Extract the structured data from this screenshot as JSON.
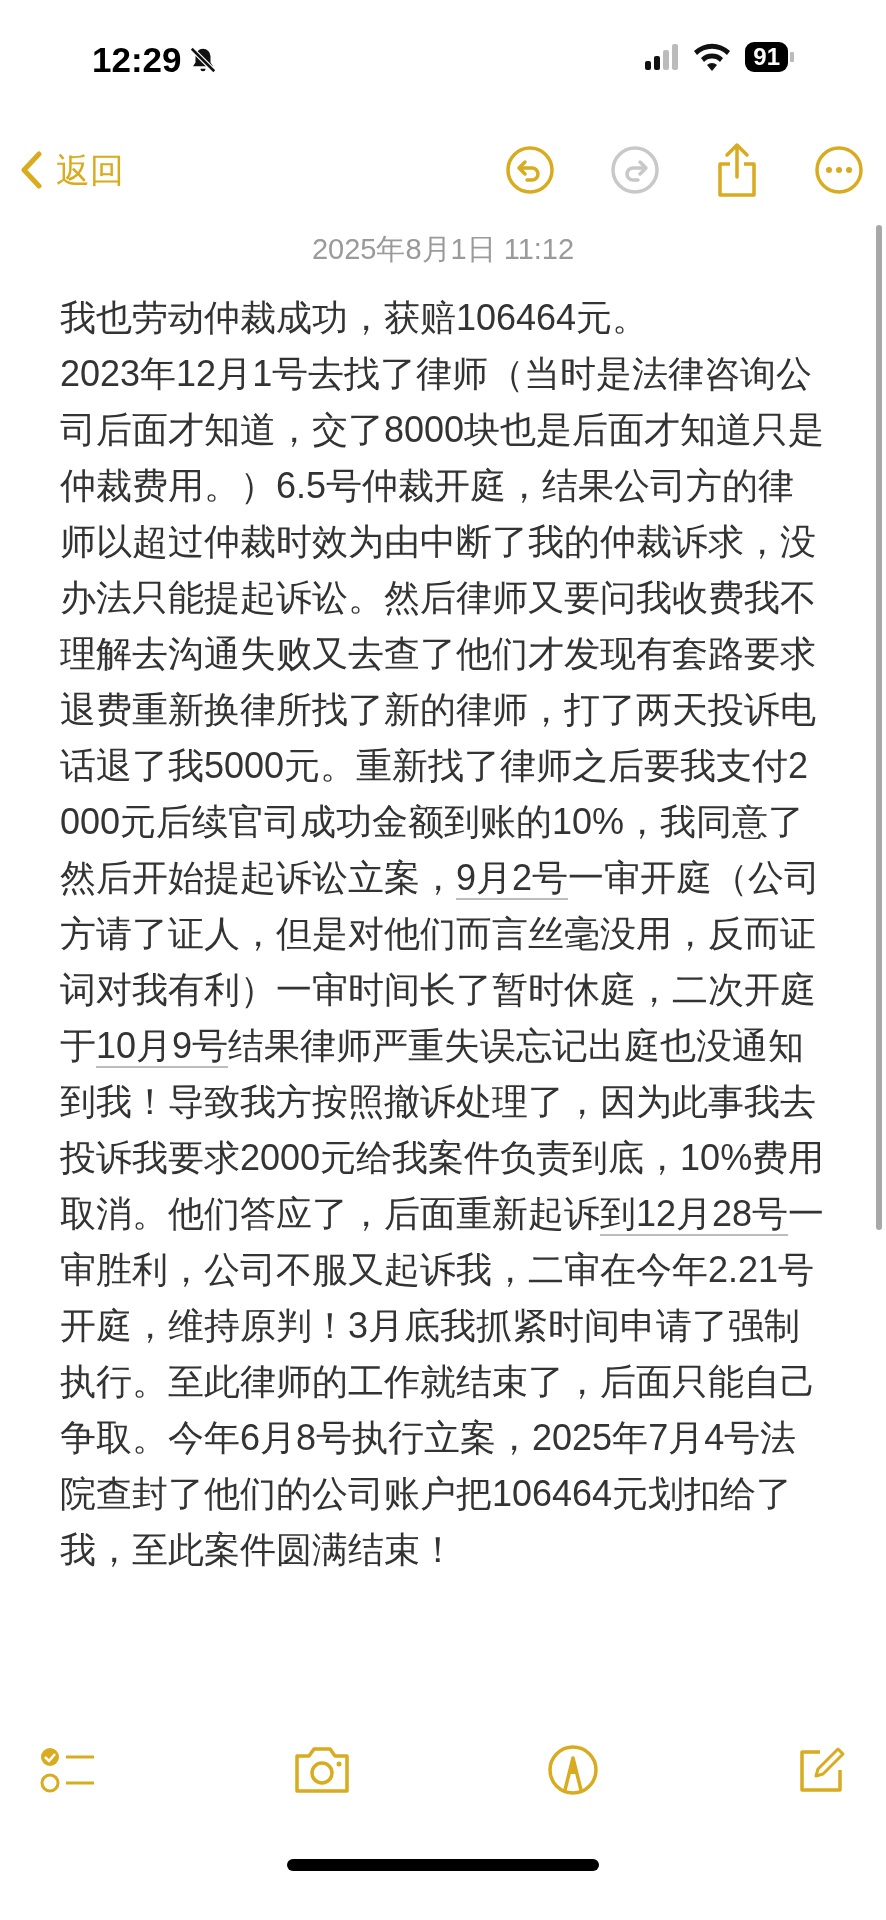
{
  "status_bar": {
    "time": "12:29",
    "battery": "91"
  },
  "nav": {
    "back": "返回",
    "redo_disabled": true
  },
  "note": {
    "date": "2025年8月1日 11:12",
    "paragraphs": [
      [
        {
          "kind": "text",
          "text": "我也劳动仲裁成功，获赔106464元。"
        }
      ],
      [
        {
          "kind": "text",
          "text": "2023年12月1号去找了律师（当时是法律咨询公司后面才知道，交了8000块也是后面才知道只是仲裁费用。）6.5号仲裁开庭，结果公司方的律师以超过仲裁时效为由中断了我的仲裁诉求，没办法只能提起诉讼。然后律师又要问我收费我不理解去沟通失败又去查了他们才发现有套路要求退费重新换律所找了新的律师，打了两天投诉电话退了我5000元。重新找了律师之后要我支付2000元后续官司成功金额到账的10%，我同意了然后开始提起诉讼立案，"
        },
        {
          "kind": "link",
          "text": "9月2号"
        },
        {
          "kind": "text",
          "text": "一审开庭（公司方请了证人，但是对他们而言丝毫没用，反而证词对我有利）一审时间长了暂时休庭，二次开庭于"
        },
        {
          "kind": "link",
          "text": "10月9号"
        },
        {
          "kind": "text",
          "text": "结果律师严重失误忘记出庭也没通知到我！导致我方按照撤诉处理了，因为此事我去投诉我要求2000元给我案件负责到底，10%费用取消。他们答应了，后面重新起诉"
        },
        {
          "kind": "link",
          "text": "到12月28号"
        },
        {
          "kind": "text",
          "text": "一审胜利，公司不服又起诉我，二审在今年2.21号开庭，维持原判！3月底我抓紧时间申请了强制执行。至此律师的工作就结束了，后面只能自己争取。今年6月8号执行立案，2025年7月4号法院查封了他们的公司账户把106464元划扣给了我，至此案件圆满结束！"
        }
      ]
    ]
  }
}
